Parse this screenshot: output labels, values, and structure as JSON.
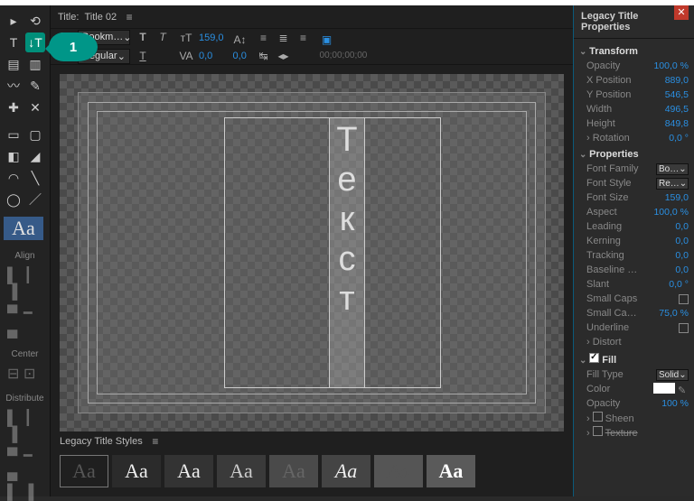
{
  "tools": {
    "swatch_text": "Aa",
    "align_label": "Align",
    "center_label": "Center",
    "distribute_label": "Distribute",
    "callout": "1"
  },
  "title_bar": {
    "prefix": "Title: ",
    "name": "Title 02"
  },
  "options": {
    "font_family": "Bookm…",
    "font_style": "Regular",
    "font_size": "159,0",
    "kerning": "0,0",
    "leading": "0,0",
    "timecode": "00;00;00;00"
  },
  "canvas": {
    "vertical_text_chars": [
      "Т",
      "е",
      "к",
      "с",
      "т"
    ]
  },
  "styles": {
    "header": "Legacy Title Styles",
    "sample": "Aa"
  },
  "props": {
    "panel_title": "Legacy Title Properties",
    "groups": {
      "transform": "Transform",
      "properties": "Properties",
      "fill": "Fill"
    },
    "transform": {
      "opacity_label": "Opacity",
      "opacity_value": "100,0 %",
      "xpos_label": "X Position",
      "xpos_value": "889,0",
      "ypos_label": "Y Position",
      "ypos_value": "546,5",
      "width_label": "Width",
      "width_value": "496,5",
      "height_label": "Height",
      "height_value": "849,8",
      "rotation_label": "Rotation",
      "rotation_value": "0,0 °"
    },
    "properties": {
      "font_family_label": "Font Family",
      "font_family_value": "Bo…",
      "font_style_label": "Font Style",
      "font_style_value": "Re…",
      "font_size_label": "Font Size",
      "font_size_value": "159,0",
      "aspect_label": "Aspect",
      "aspect_value": "100,0 %",
      "leading_label": "Leading",
      "leading_value": "0,0",
      "kerning_label": "Kerning",
      "kerning_value": "0,0",
      "tracking_label": "Tracking",
      "tracking_value": "0,0",
      "baseline_label": "Baseline …",
      "baseline_value": "0,0",
      "slant_label": "Slant",
      "slant_value": "0,0 °",
      "smallcaps_label": "Small Caps",
      "smallcapssize_label": "Small Ca…",
      "smallcapssize_value": "75,0 %",
      "underline_label": "Underline",
      "distort_label": "Distort"
    },
    "fill": {
      "filltype_label": "Fill Type",
      "filltype_value": "Solid",
      "color_label": "Color",
      "opacity_label": "Opacity",
      "opacity_value": "100 %",
      "sheen_label": "Sheen",
      "texture_label": "Texture"
    }
  }
}
